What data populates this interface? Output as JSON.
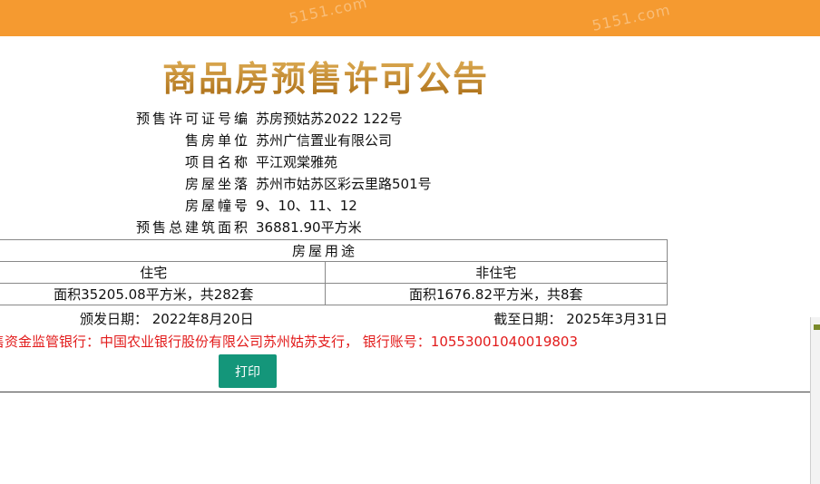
{
  "watermarks": [
    "5151.com",
    "5151.com"
  ],
  "title": "商品房预售许可公告",
  "info": [
    {
      "label": "预售许可证号编",
      "value": "苏房预姑苏2022 122号"
    },
    {
      "label": "售房单位",
      "value": "苏州广信置业有限公司"
    },
    {
      "label": "项目名称",
      "value": "平江观棠雅苑"
    },
    {
      "label": "房屋坐落",
      "value": "苏州市姑苏区彩云里路501号"
    },
    {
      "label": "房屋幢号",
      "value": "9、10、11、12"
    },
    {
      "label": "预售总建筑面积",
      "value": "36881.90平方米"
    }
  ],
  "colon": "：",
  "usage_table": {
    "header": "房屋用途",
    "columns": [
      "住宅",
      "非住宅"
    ],
    "values": [
      "面积35205.08平方米，共282套",
      "面积1676.82平方米，共8套"
    ]
  },
  "dates": {
    "issue": "颁发日期：  2022年8月20日",
    "expiry": "截至日期：  2025年3月31日"
  },
  "bank_line": "售资金监管银行：中国农业银行股份有限公司苏州姑苏支行，  银行账号：10553001040019803",
  "print_button": "打印",
  "colors": {
    "topbar": "#f59a30",
    "title_gold": "#b8791a",
    "bank_red": "#e21b1b",
    "button_green": "#14967a"
  }
}
